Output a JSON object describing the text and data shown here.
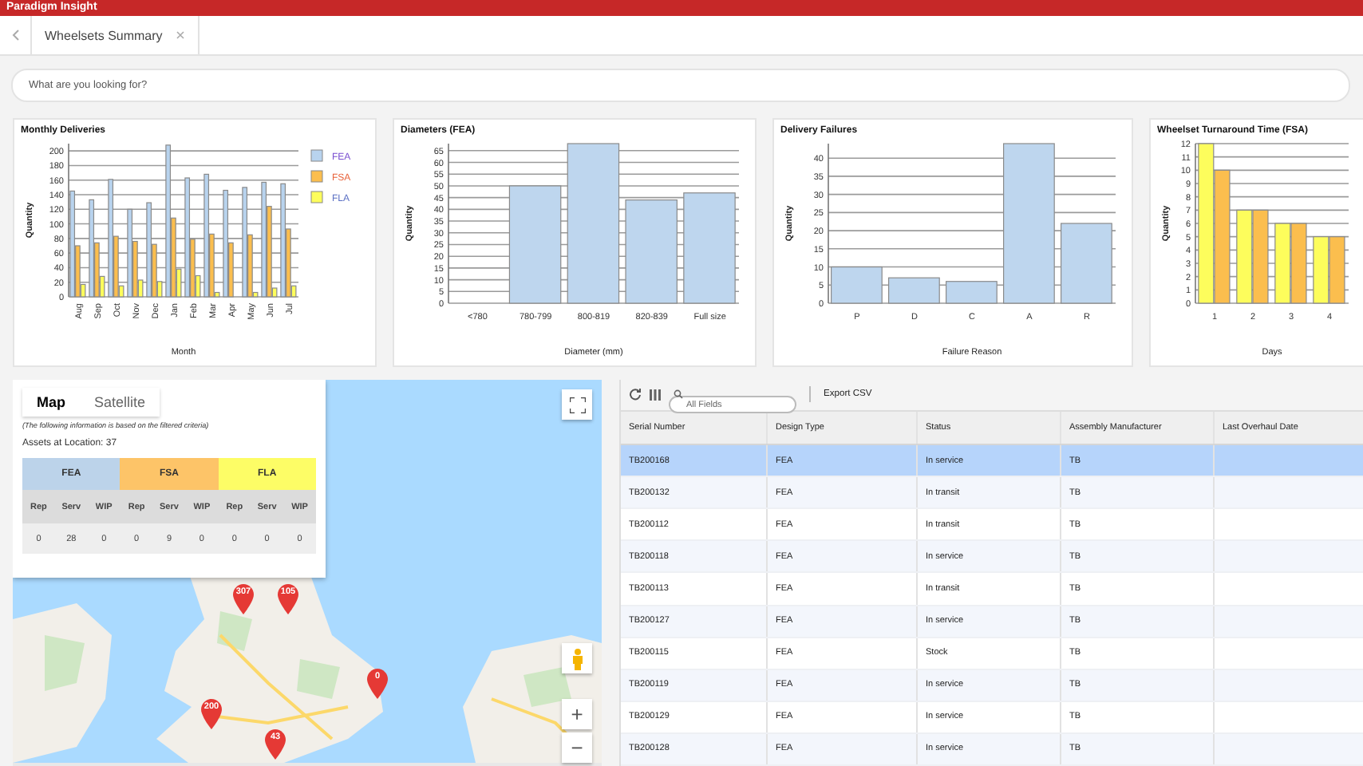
{
  "app_bar": {
    "title": "Paradigm Insight"
  },
  "tabs": [
    {
      "label": "Wheelsets Summary",
      "selected": true
    }
  ],
  "search": {
    "placeholder": "What are you looking for?"
  },
  "charts": [
    {
      "title": "Monthly Deliveries",
      "chart_data": {
        "type": "bar",
        "grid": true,
        "legend": "right",
        "xlabel": "Month",
        "ylabel": "Quantity",
        "categories": [
          "Aug",
          "Sep",
          "Oct",
          "Nov",
          "Dec",
          "Jan",
          "Feb",
          "Mar",
          "Apr",
          "May",
          "Jun",
          "Jul"
        ],
        "ylim": [
          0,
          210
        ],
        "yticks": [
          0,
          20,
          40,
          60,
          80,
          100,
          120,
          140,
          160,
          180,
          200
        ],
        "series": [
          {
            "name": "FEA",
            "color": "#b8d3ee",
            "values": [
              145,
              133,
              161,
              120,
              129,
              208,
              163,
              168,
              146,
              150,
              157,
              155
            ]
          },
          {
            "name": "FSA",
            "color": "#fbbe4e",
            "values": [
              70,
              74,
              83,
              76,
              72,
              108,
              79,
              86,
              74,
              85,
              124,
              93
            ]
          },
          {
            "name": "FLA",
            "color": "#fdfd5c",
            "values": [
              17,
              28,
              15,
              23,
              21,
              38,
              29,
              6,
              0,
              6,
              12,
              15
            ]
          }
        ]
      }
    },
    {
      "title": "Diameters (FEA)",
      "chart_data": {
        "type": "bar",
        "grid": true,
        "xlabel": "Diameter (mm)",
        "ylabel": "Quantity",
        "categories": [
          "<780",
          "780-799",
          "800-819",
          "820-839",
          "Full size"
        ],
        "ylim": [
          0,
          68
        ],
        "yticks": [
          0,
          5,
          10,
          15,
          20,
          25,
          30,
          35,
          40,
          45,
          50,
          55,
          60,
          65
        ],
        "series": [
          {
            "color": "#bed6ee",
            "values": [
              0,
              50,
              68,
              44,
              47
            ]
          }
        ]
      }
    },
    {
      "title": "Delivery Failures",
      "chart_data": {
        "type": "bar",
        "grid": true,
        "xlabel": "Failure Reason",
        "ylabel": "Quantity",
        "categories": [
          "P",
          "D",
          "C",
          "A",
          "R"
        ],
        "ylim": [
          0,
          44
        ],
        "yticks": [
          0,
          5,
          10,
          15,
          20,
          25,
          30,
          35,
          40
        ],
        "series": [
          {
            "color": "#bed6ee",
            "values": [
              10,
              7,
              6,
              44,
              22
            ]
          }
        ]
      }
    },
    {
      "title": "Wheelset Turnaround Time (FSA)",
      "chart_data": {
        "type": "bar",
        "grid": true,
        "xlabel": "Days",
        "ylabel": "Quantity",
        "categories": [
          "1",
          "2",
          "3",
          "4"
        ],
        "ylim": [
          0,
          12
        ],
        "yticks": [
          0,
          1,
          2,
          3,
          4,
          5,
          6,
          7,
          8,
          9,
          10,
          11,
          12
        ],
        "series": [
          {
            "color": "#fdfd5c",
            "values": [
              12,
              7,
              6,
              5
            ]
          },
          {
            "color": "#fbbe4e",
            "values": [
              10,
              7,
              6,
              5
            ]
          }
        ]
      }
    }
  ],
  "map": {
    "kind": "picture",
    "map_types": [
      {
        "label": "Map",
        "selected": true
      },
      {
        "label": "Satellite",
        "selected": false
      }
    ],
    "note": "(The following information is based on the filtered criteria)",
    "assets": "Assets at Location: 37",
    "groups": [
      {
        "label": "FEA",
        "color": "#bcd3ea",
        "columns": [
          "Rep",
          "Serv",
          "WIP"
        ],
        "values": [
          "0",
          "28",
          "0"
        ]
      },
      {
        "label": "FSA",
        "color": "#fdc468",
        "columns": [
          "Rep",
          "Serv",
          "WIP"
        ],
        "values": [
          "0",
          "9",
          "0"
        ]
      },
      {
        "label": "FLA",
        "color": "#fdfd66",
        "columns": [
          "Rep",
          "Serv",
          "WIP"
        ],
        "values": [
          "0",
          "0",
          "0"
        ]
      }
    ],
    "markers": [
      "307",
      "105",
      "200",
      "0",
      "43"
    ],
    "zoom_in": "+",
    "zoom_out": "−"
  },
  "grid": {
    "search_placeholder": "All Fields",
    "export": "Export CSV",
    "columns": [
      "Serial Number",
      "Design Type",
      "Status",
      "Assembly Manufacturer",
      "Last Overhaul Date"
    ],
    "rows": [
      {
        "selected": true,
        "cells": [
          "TB200168",
          "FEA",
          "In service",
          "TB"
        ]
      },
      {
        "selected": false,
        "cells": [
          "TB200132",
          "FEA",
          "In transit",
          "TB"
        ]
      },
      {
        "selected": false,
        "cells": [
          "TB200112",
          "FEA",
          "In transit",
          "TB"
        ]
      },
      {
        "selected": false,
        "cells": [
          "TB200118",
          "FEA",
          "In service",
          "TB"
        ]
      },
      {
        "selected": false,
        "cells": [
          "TB200113",
          "FEA",
          "In transit",
          "TB"
        ]
      },
      {
        "selected": false,
        "cells": [
          "TB200127",
          "FEA",
          "In service",
          "TB"
        ]
      },
      {
        "selected": false,
        "cells": [
          "TB200115",
          "FEA",
          "Stock",
          "TB"
        ]
      },
      {
        "selected": false,
        "cells": [
          "TB200119",
          "FEA",
          "In service",
          "TB"
        ]
      },
      {
        "selected": false,
        "cells": [
          "TB200129",
          "FEA",
          "In service",
          "TB"
        ]
      },
      {
        "selected": false,
        "cells": [
          "TB200128",
          "FEA",
          "In service",
          "TB"
        ]
      }
    ]
  }
}
